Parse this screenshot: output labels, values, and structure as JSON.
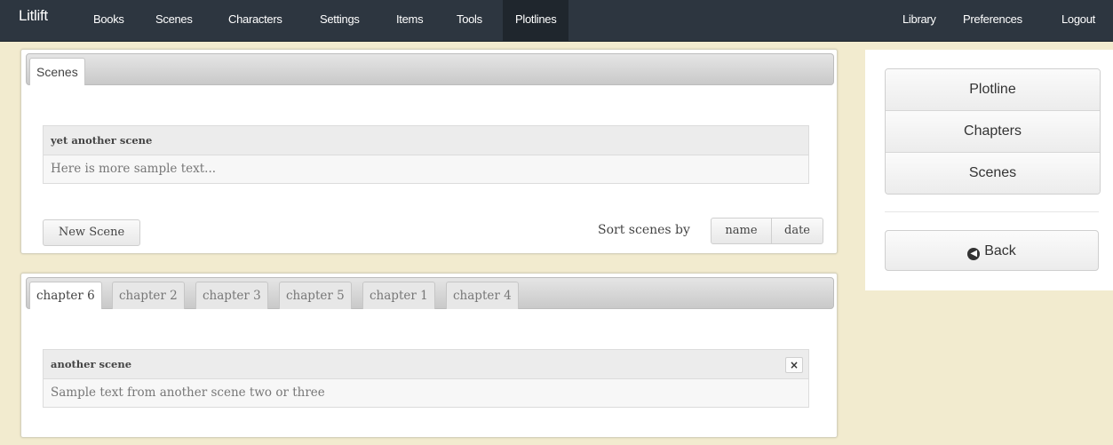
{
  "navbar": {
    "brand": "Litlift",
    "left_items": [
      "Books",
      "Scenes",
      "Characters",
      "Settings",
      "Items",
      "Tools",
      "Plotlines"
    ],
    "active_item": "Plotlines",
    "right_items": [
      "Library",
      "Preferences",
      "Logout"
    ]
  },
  "scenes_panel": {
    "tab_label": "Scenes",
    "scene": {
      "title": "yet another scene",
      "text": "Here is more sample text..."
    },
    "new_scene_label": "New Scene",
    "sort_label": "Sort scenes by",
    "sort_options": [
      "name",
      "date"
    ]
  },
  "chapters_panel": {
    "tabs": [
      "chapter 6",
      "chapter 2",
      "chapter 3",
      "chapter 5",
      "chapter 1",
      "chapter 4"
    ],
    "active_tab": "chapter 6",
    "scene": {
      "title": "another scene",
      "text": "Sample text from another scene two or three",
      "close_label": "×"
    }
  },
  "sidebar": {
    "buttons": [
      "Plotline",
      "Chapters",
      "Scenes"
    ],
    "back_label": "Back"
  },
  "colors": {
    "navbar_bg": "#2d3640",
    "page_bg": "#f2ebcf"
  }
}
